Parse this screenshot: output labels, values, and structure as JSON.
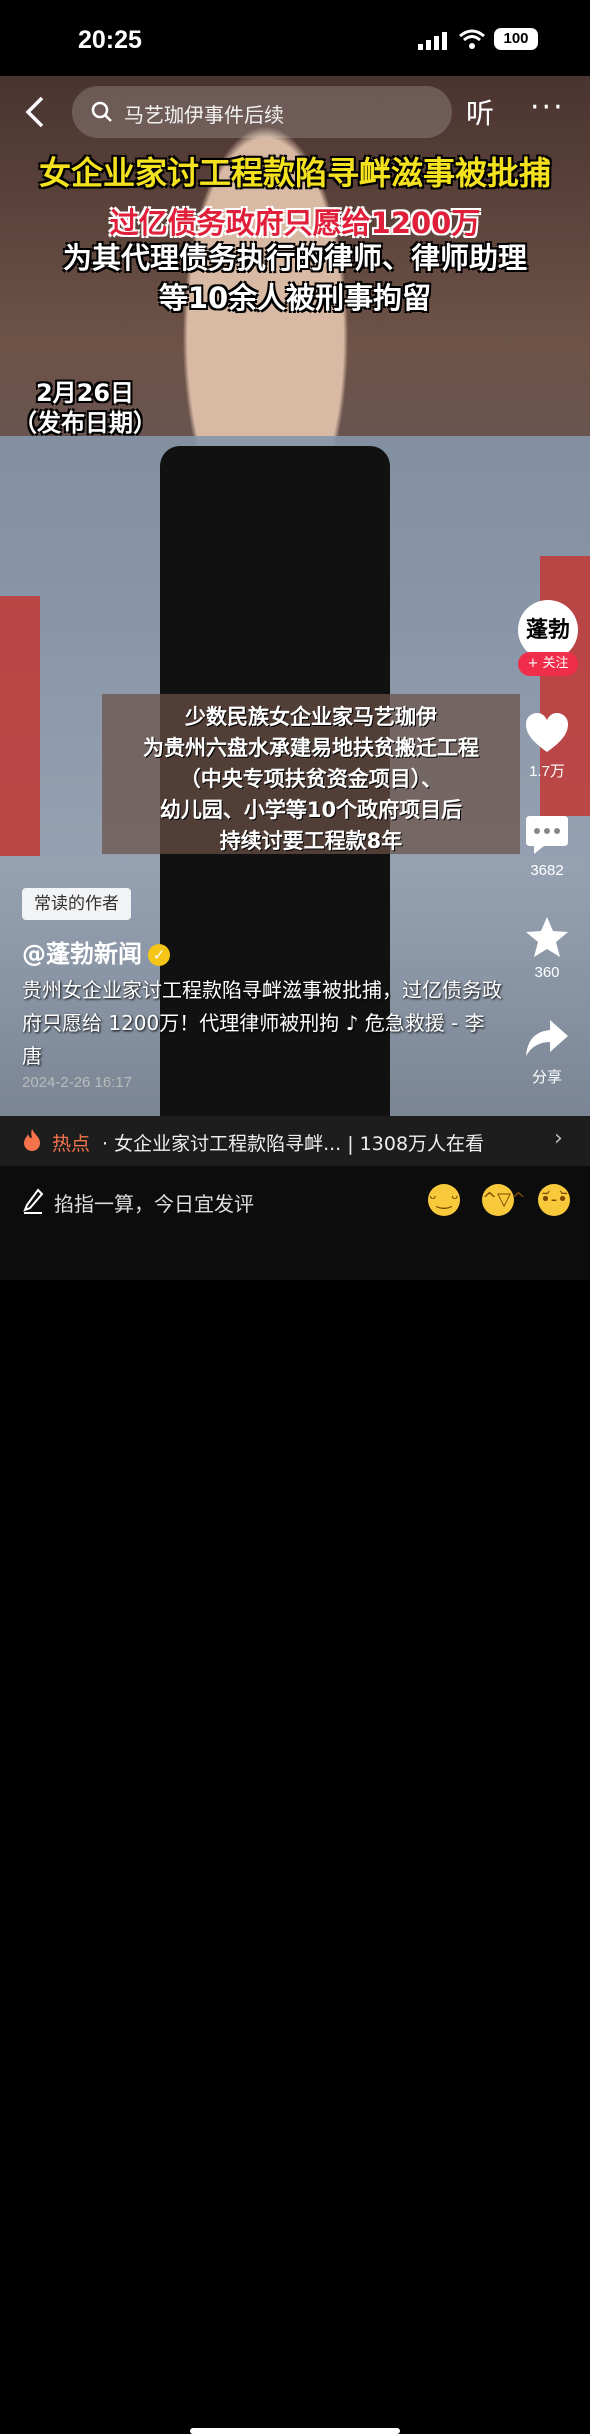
{
  "status_bar": {
    "time": "20:25",
    "battery": "100"
  },
  "search": {
    "query": "马艺珈伊事件后续",
    "listen_label": "听",
    "more_label": "···"
  },
  "video_overlay": {
    "headline": "女企业家讨工程款陷寻衅滋事被批捕",
    "subhead_red": "过亿债务政府只愿给1200万",
    "subhead_lines": [
      "为其代理债务执行的律师、律师助理",
      "等10余人被刑事拘留"
    ],
    "date_lines": [
      "2月26日",
      "（发布日期）"
    ],
    "info_lines": [
      "少数民族女企业家马艺珈伊",
      "为贵州六盘水承建易地扶贫搬迁工程",
      "（中央专项扶贫资金项目）、",
      "幼儿园、小学等10个政府项目后",
      "持续讨要工程款8年"
    ]
  },
  "right_rail": {
    "avatar_text": "蓬勃",
    "follow_label": "+ 关注",
    "likes": "1.7万",
    "comments": "3682",
    "favorites": "360",
    "share_label": "分享"
  },
  "post": {
    "badge": "常读的作者",
    "author": "@蓬勃新闻",
    "description": "贵州女企业家讨工程款陷寻衅滋事被批捕，过亿债务政府只愿给 1200万！代理律师被刑拘 ♪ 危急救援 - 李唐",
    "timestamp": "2024-2-26 16:17"
  },
  "hot_bar": {
    "label": "热点",
    "text": "· 女企业家讨工程款陷寻衅... | 1308万人在看"
  },
  "comment_bar": {
    "placeholder": "掐指一算，今日宜发评"
  }
}
